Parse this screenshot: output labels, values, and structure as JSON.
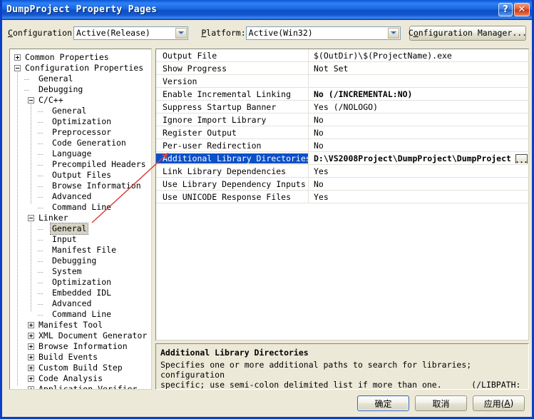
{
  "window": {
    "title": "DumpProject Property Pages",
    "help_button": "?",
    "close_button": "✕"
  },
  "toolbar": {
    "configuration_label": "Configuration:",
    "configuration_label_accel": "C",
    "configuration_value": "Active(Release)",
    "platform_label": "Platform:",
    "platform_label_accel": "P",
    "platform_value": "Active(Win32)",
    "config_manager_label": "Configuration Manager...",
    "config_manager_accel": "o"
  },
  "tree": {
    "nodes": [
      {
        "label": "Common Properties",
        "level": 0,
        "toggle": "plus",
        "selected": false
      },
      {
        "label": "Configuration Properties",
        "level": 0,
        "toggle": "minus",
        "selected": false
      },
      {
        "label": "General",
        "level": 1,
        "toggle": "none",
        "selected": false
      },
      {
        "label": "Debugging",
        "level": 1,
        "toggle": "none",
        "selected": false
      },
      {
        "label": "C/C++",
        "level": 1,
        "toggle": "minus",
        "selected": false
      },
      {
        "label": "General",
        "level": 2,
        "toggle": "none",
        "selected": false
      },
      {
        "label": "Optimization",
        "level": 2,
        "toggle": "none",
        "selected": false
      },
      {
        "label": "Preprocessor",
        "level": 2,
        "toggle": "none",
        "selected": false
      },
      {
        "label": "Code Generation",
        "level": 2,
        "toggle": "none",
        "selected": false
      },
      {
        "label": "Language",
        "level": 2,
        "toggle": "none",
        "selected": false
      },
      {
        "label": "Precompiled Headers",
        "level": 2,
        "toggle": "none",
        "selected": false
      },
      {
        "label": "Output Files",
        "level": 2,
        "toggle": "none",
        "selected": false
      },
      {
        "label": "Browse Information",
        "level": 2,
        "toggle": "none",
        "selected": false
      },
      {
        "label": "Advanced",
        "level": 2,
        "toggle": "none",
        "selected": false
      },
      {
        "label": "Command Line",
        "level": 2,
        "toggle": "none",
        "selected": false
      },
      {
        "label": "Linker",
        "level": 1,
        "toggle": "minus",
        "selected": false
      },
      {
        "label": "General",
        "level": 2,
        "toggle": "none",
        "selected": true
      },
      {
        "label": "Input",
        "level": 2,
        "toggle": "none",
        "selected": false
      },
      {
        "label": "Manifest File",
        "level": 2,
        "toggle": "none",
        "selected": false
      },
      {
        "label": "Debugging",
        "level": 2,
        "toggle": "none",
        "selected": false
      },
      {
        "label": "System",
        "level": 2,
        "toggle": "none",
        "selected": false
      },
      {
        "label": "Optimization",
        "level": 2,
        "toggle": "none",
        "selected": false
      },
      {
        "label": "Embedded IDL",
        "level": 2,
        "toggle": "none",
        "selected": false
      },
      {
        "label": "Advanced",
        "level": 2,
        "toggle": "none",
        "selected": false
      },
      {
        "label": "Command Line",
        "level": 2,
        "toggle": "none",
        "selected": false
      },
      {
        "label": "Manifest Tool",
        "level": 1,
        "toggle": "plus",
        "selected": false
      },
      {
        "label": "XML Document Generator",
        "level": 1,
        "toggle": "plus",
        "selected": false
      },
      {
        "label": "Browse Information",
        "level": 1,
        "toggle": "plus",
        "selected": false
      },
      {
        "label": "Build Events",
        "level": 1,
        "toggle": "plus",
        "selected": false
      },
      {
        "label": "Custom Build Step",
        "level": 1,
        "toggle": "plus",
        "selected": false
      },
      {
        "label": "Code Analysis",
        "level": 1,
        "toggle": "plus",
        "selected": false
      },
      {
        "label": "Application Verifier",
        "level": 1,
        "toggle": "plus",
        "selected": false
      }
    ]
  },
  "grid": {
    "rows": [
      {
        "name": "Output File",
        "value": "$(OutDir)\\$(ProjectName).exe",
        "bold": false,
        "selected": false,
        "browse": false
      },
      {
        "name": "Show Progress",
        "value": "Not Set",
        "bold": false,
        "selected": false,
        "browse": false
      },
      {
        "name": "Version",
        "value": "",
        "bold": false,
        "selected": false,
        "browse": false
      },
      {
        "name": "Enable Incremental Linking",
        "value": "No  (/INCREMENTAL:NO)",
        "bold": true,
        "selected": false,
        "browse": false
      },
      {
        "name": "Suppress Startup Banner",
        "value": "Yes (/NOLOGO)",
        "bold": false,
        "selected": false,
        "browse": false
      },
      {
        "name": "Ignore Import Library",
        "value": "No",
        "bold": false,
        "selected": false,
        "browse": false
      },
      {
        "name": "Register Output",
        "value": "No",
        "bold": false,
        "selected": false,
        "browse": false
      },
      {
        "name": "Per-user Redirection",
        "value": "No",
        "bold": false,
        "selected": false,
        "browse": false
      },
      {
        "name": "Additional Library Directories",
        "value": "D:\\VS2008Project\\DumpProject\\DumpProject",
        "bold": true,
        "selected": true,
        "browse": true
      },
      {
        "name": "Link Library Dependencies",
        "value": "Yes",
        "bold": false,
        "selected": false,
        "browse": false
      },
      {
        "name": "Use Library Dependency Inputs",
        "value": "No",
        "bold": false,
        "selected": false,
        "browse": false
      },
      {
        "name": "Use UNICODE Response Files",
        "value": "Yes",
        "bold": false,
        "selected": false,
        "browse": false
      }
    ],
    "browse_button_label": "..."
  },
  "description": {
    "title": "Additional Library Directories",
    "body": "Specifies one or more additional paths to search for libraries; configuration\nspecific; use semi-colon delimited list if more than one.      (/LIBPATH:[dir])"
  },
  "buttons": {
    "ok": "确定",
    "cancel": "取消",
    "apply_prefix": "应用(",
    "apply_accel": "A",
    "apply_suffix": ")"
  },
  "annotation": {
    "color": "#d94040",
    "type": "arrow"
  },
  "colors": {
    "title_bar_blue": "#1b6ae6",
    "dialog_face": "#ece9d8",
    "selection_blue": "#0a50c8",
    "tree_selection_gray": "#d6d2c2"
  }
}
